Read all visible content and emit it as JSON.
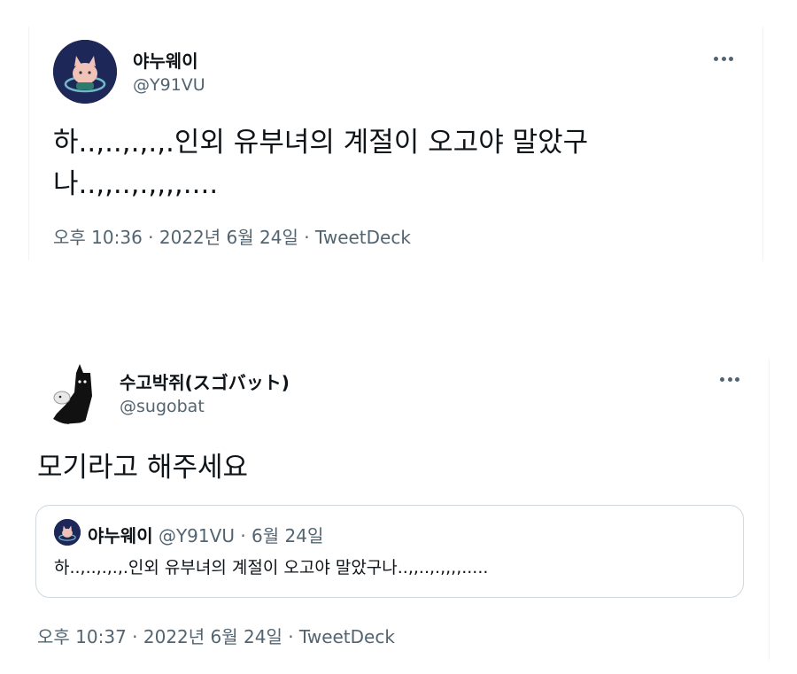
{
  "tweet1": {
    "display_name": "야누웨이",
    "handle": "@Y91VU",
    "text": "하..,..,.,.,.인외 유부녀의 계절이 오고야 말았구\n나..,,..,.,,,,....",
    "meta": "오후 10:36 · 2022년 6월 24일 · TweetDeck"
  },
  "tweet2": {
    "display_name": "수고박쥐(スゴバット)",
    "handle": "@sugobat",
    "text": "모기라고 해주세요",
    "meta": "오후 10:37 · 2022년 6월 24일 · TweetDeck",
    "quote": {
      "display_name": "야누웨이",
      "handle": "@Y91VU",
      "separator": "·",
      "date": "6월 24일",
      "text": "하..,..,.,.,.인외 유부녀의 계절이 오고야 말았구나..,,..,.,,,,....."
    }
  },
  "icons": {
    "more": "more-horizontal-icon"
  }
}
